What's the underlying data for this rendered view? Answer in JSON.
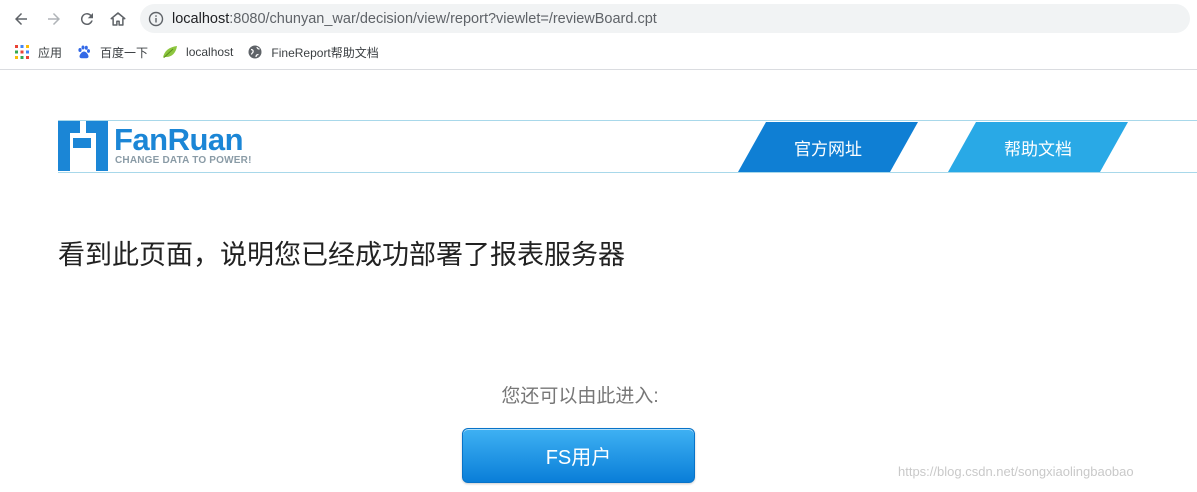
{
  "browser": {
    "url_host": "localhost",
    "url_rest": ":8080/chunyan_war/decision/view/report?viewlet=/reviewBoard.cpt",
    "bookmarks": [
      {
        "label": "应用",
        "icon": "apps-grid-icon"
      },
      {
        "label": "百度一下",
        "icon": "baidu-paw-icon"
      },
      {
        "label": "localhost",
        "icon": "leaf-icon"
      },
      {
        "label": "FineReport帮助文档",
        "icon": "globe-icon"
      }
    ]
  },
  "header": {
    "logo_word": "FanRuan",
    "logo_tagline": "CHANGE DATA TO POWER!",
    "tab_official": "官方网址",
    "tab_help": "帮助文档"
  },
  "main": {
    "headline": "看到此页面，说明您已经成功部署了报表服务器",
    "subline": "您还可以由此进入:",
    "fs_button": "FS用户"
  },
  "watermark": "https://blog.csdn.net/songxiaolingbaobao",
  "colors": {
    "brand_blue": "#1b86d6",
    "tab_dark": "#0f7fd4",
    "tab_light": "#29a9e6"
  }
}
